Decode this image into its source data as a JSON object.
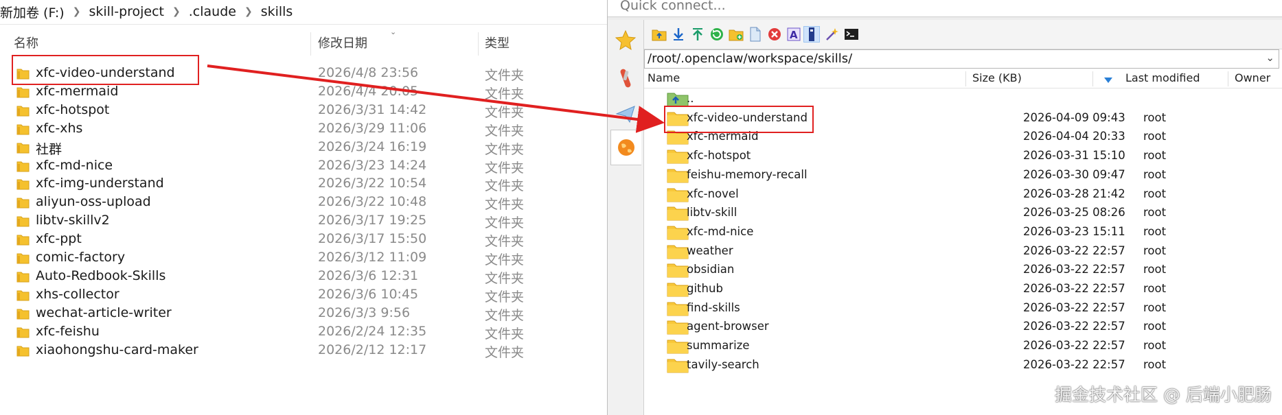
{
  "explorer": {
    "breadcrumb": [
      "新加卷 (F:)",
      "skill-project",
      ".claude",
      "skills"
    ],
    "columns": {
      "name": "名称",
      "modified": "修改日期",
      "type": "类型"
    },
    "rows": [
      {
        "name": "xfc-video-understand",
        "date": "2026/4/8 23:56",
        "type": "文件夹"
      },
      {
        "name": "xfc-mermaid",
        "date": "2026/4/4 20:05",
        "type": "文件夹"
      },
      {
        "name": "xfc-hotspot",
        "date": "2026/3/31 14:42",
        "type": "文件夹"
      },
      {
        "name": "xfc-xhs",
        "date": "2026/3/29 11:06",
        "type": "文件夹"
      },
      {
        "name": "社群",
        "date": "2026/3/24 16:19",
        "type": "文件夹"
      },
      {
        "name": "xfc-md-nice",
        "date": "2026/3/23 14:24",
        "type": "文件夹"
      },
      {
        "name": "xfc-img-understand",
        "date": "2026/3/22 10:54",
        "type": "文件夹"
      },
      {
        "name": "aliyun-oss-upload",
        "date": "2026/3/22 10:48",
        "type": "文件夹"
      },
      {
        "name": "libtv-skillv2",
        "date": "2026/3/17 19:25",
        "type": "文件夹"
      },
      {
        "name": "xfc-ppt",
        "date": "2026/3/17 15:50",
        "type": "文件夹"
      },
      {
        "name": "comic-factory",
        "date": "2026/3/12 11:09",
        "type": "文件夹"
      },
      {
        "name": "Auto-Redbook-Skills",
        "date": "2026/3/6 12:31",
        "type": "文件夹"
      },
      {
        "name": "xhs-collector",
        "date": "2026/3/6 10:45",
        "type": "文件夹"
      },
      {
        "name": "wechat-article-writer",
        "date": "2026/3/3 9:56",
        "type": "文件夹"
      },
      {
        "name": "xfc-feishu",
        "date": "2026/2/24 12:35",
        "type": "文件夹"
      },
      {
        "name": "xiaohongshu-card-maker",
        "date": "2026/2/12 12:17",
        "type": "文件夹"
      }
    ]
  },
  "client": {
    "quick_connect": "Quick connect...",
    "path": "/root/.openclaw/workspace/skills/",
    "columns": {
      "name": "Name",
      "size": "Size (KB)",
      "modified": "Last modified",
      "owner": "Owner"
    },
    "parent": "..",
    "rows": [
      {
        "name": "xfc-video-understand",
        "modified": "2026-04-09 09:43",
        "owner": "root"
      },
      {
        "name": "xfc-mermaid",
        "modified": "2026-04-04 20:33",
        "owner": "root"
      },
      {
        "name": "xfc-hotspot",
        "modified": "2026-03-31 15:10",
        "owner": "root"
      },
      {
        "name": "feishu-memory-recall",
        "modified": "2026-03-30 09:47",
        "owner": "root"
      },
      {
        "name": "xfc-novel",
        "modified": "2026-03-28 21:42",
        "owner": "root"
      },
      {
        "name": "libtv-skill",
        "modified": "2026-03-25 08:26",
        "owner": "root"
      },
      {
        "name": "xfc-md-nice",
        "modified": "2026-03-23 15:11",
        "owner": "root"
      },
      {
        "name": "weather",
        "modified": "2026-03-22 22:57",
        "owner": "root"
      },
      {
        "name": "obsidian",
        "modified": "2026-03-22 22:57",
        "owner": "root"
      },
      {
        "name": "github",
        "modified": "2026-03-22 22:57",
        "owner": "root"
      },
      {
        "name": "find-skills",
        "modified": "2026-03-22 22:57",
        "owner": "root"
      },
      {
        "name": "agent-browser",
        "modified": "2026-03-22 22:57",
        "owner": "root"
      },
      {
        "name": "summarize",
        "modified": "2026-03-22 22:57",
        "owner": "root"
      },
      {
        "name": "tavily-search",
        "modified": "2026-03-22 22:57",
        "owner": "root"
      }
    ]
  },
  "watermark": "掘金技术社区 @ 后端小肥肠",
  "colors": {
    "highlight": "#e02020",
    "folder": "#f5c12e",
    "folder_dark": "#e0a51a"
  }
}
